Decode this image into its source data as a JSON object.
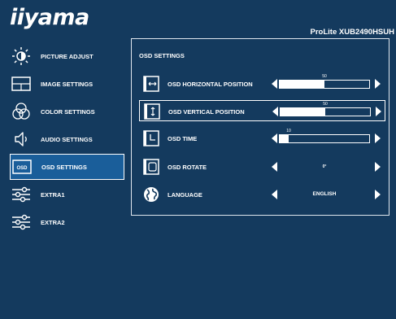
{
  "header": {
    "logo": "iiyama",
    "model": "ProLite XUB2490HSUH"
  },
  "sidebar": {
    "items": [
      {
        "label": "PICTURE ADJUST",
        "icon": "sun-brightness-icon"
      },
      {
        "label": "IMAGE SETTINGS",
        "icon": "image-frame-icon"
      },
      {
        "label": "COLOR SETTINGS",
        "icon": "rgb-circles-icon"
      },
      {
        "label": "AUDIO SETTINGS",
        "icon": "speaker-icon"
      },
      {
        "label": "OSD SETTINGS",
        "icon": "osd-icon",
        "icon_text": "OSD",
        "active": true
      },
      {
        "label": "EXTRA1",
        "icon": "sliders-icon"
      },
      {
        "label": "EXTRA2",
        "icon": "sliders-icon"
      }
    ]
  },
  "panel": {
    "title": "OSD SETTINGS",
    "rows": [
      {
        "label": "OSD HORIZONTAL POSITION",
        "icon": "horizontal-position-icon",
        "value": "50",
        "level": 0.5
      },
      {
        "label": "OSD VERTICAL POSITION",
        "icon": "vertical-position-icon",
        "value": "50",
        "level": 0.5,
        "active": true
      },
      {
        "label": "OSD TIME",
        "icon": "timer-icon",
        "value": "10",
        "level": 0.1
      },
      {
        "label": "OSD ROTATE",
        "icon": "rotate-icon",
        "value": "0°"
      },
      {
        "label": "LANGUAGE",
        "icon": "globe-icon",
        "value": "ENGLISH"
      }
    ]
  },
  "colors": {
    "background": "#143a5e",
    "highlight": "#1a5e9a",
    "text": "#ffffff"
  }
}
